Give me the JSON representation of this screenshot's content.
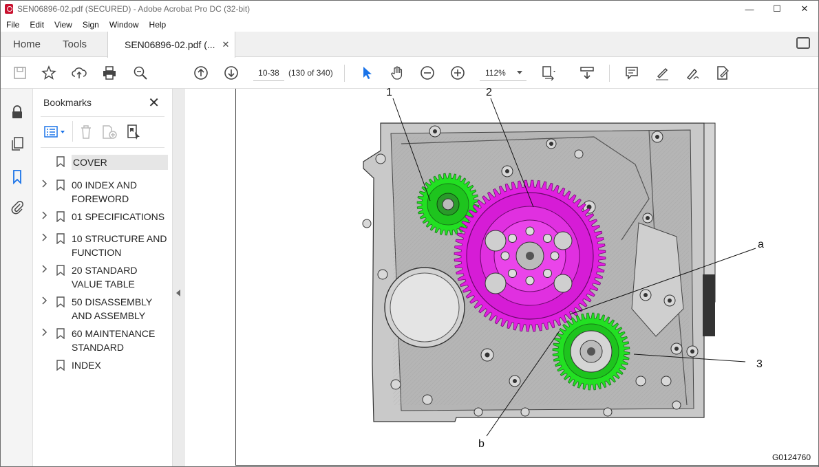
{
  "window": {
    "title": "SEN06896-02.pdf (SECURED) - Adobe Acrobat Pro DC (32-bit)",
    "minimize": "—",
    "maximize": "☐",
    "close": "✕"
  },
  "menu": [
    "File",
    "Edit",
    "View",
    "Sign",
    "Window",
    "Help"
  ],
  "tabs": {
    "home": "Home",
    "tools": "Tools",
    "document": "SEN06896-02.pdf (...",
    "close": "✕"
  },
  "toolbar": {
    "page_value": "10-38",
    "page_count": "(130 of 340)",
    "zoom": "112%"
  },
  "bookmarks": {
    "title": "Bookmarks",
    "close": "✕",
    "items": [
      {
        "label": "COVER",
        "expandable": false,
        "selected": true
      },
      {
        "label": "00 INDEX AND FOREWORD",
        "expandable": true,
        "selected": false
      },
      {
        "label": "01 SPECIFICATIONS",
        "expandable": true,
        "selected": false
      },
      {
        "label": "10 STRUCTURE AND FUNCTION",
        "expandable": true,
        "selected": false
      },
      {
        "label": "20 STANDARD VALUE TABLE",
        "expandable": true,
        "selected": false
      },
      {
        "label": "50 DISASSEMBLY AND ASSEMBLY",
        "expandable": true,
        "selected": false
      },
      {
        "label": "60 MAINTENANCE STANDARD",
        "expandable": true,
        "selected": false
      },
      {
        "label": "INDEX",
        "expandable": false,
        "selected": false
      }
    ]
  },
  "figure": {
    "callouts": {
      "c1": "1",
      "c2": "2",
      "c3": "3",
      "ca": "a",
      "cb": "b"
    },
    "figure_id": "G0124760",
    "colors": {
      "magenta_gear": "#e020e0",
      "green_gear": "#22e022",
      "housing": "#bfbfbf"
    }
  }
}
